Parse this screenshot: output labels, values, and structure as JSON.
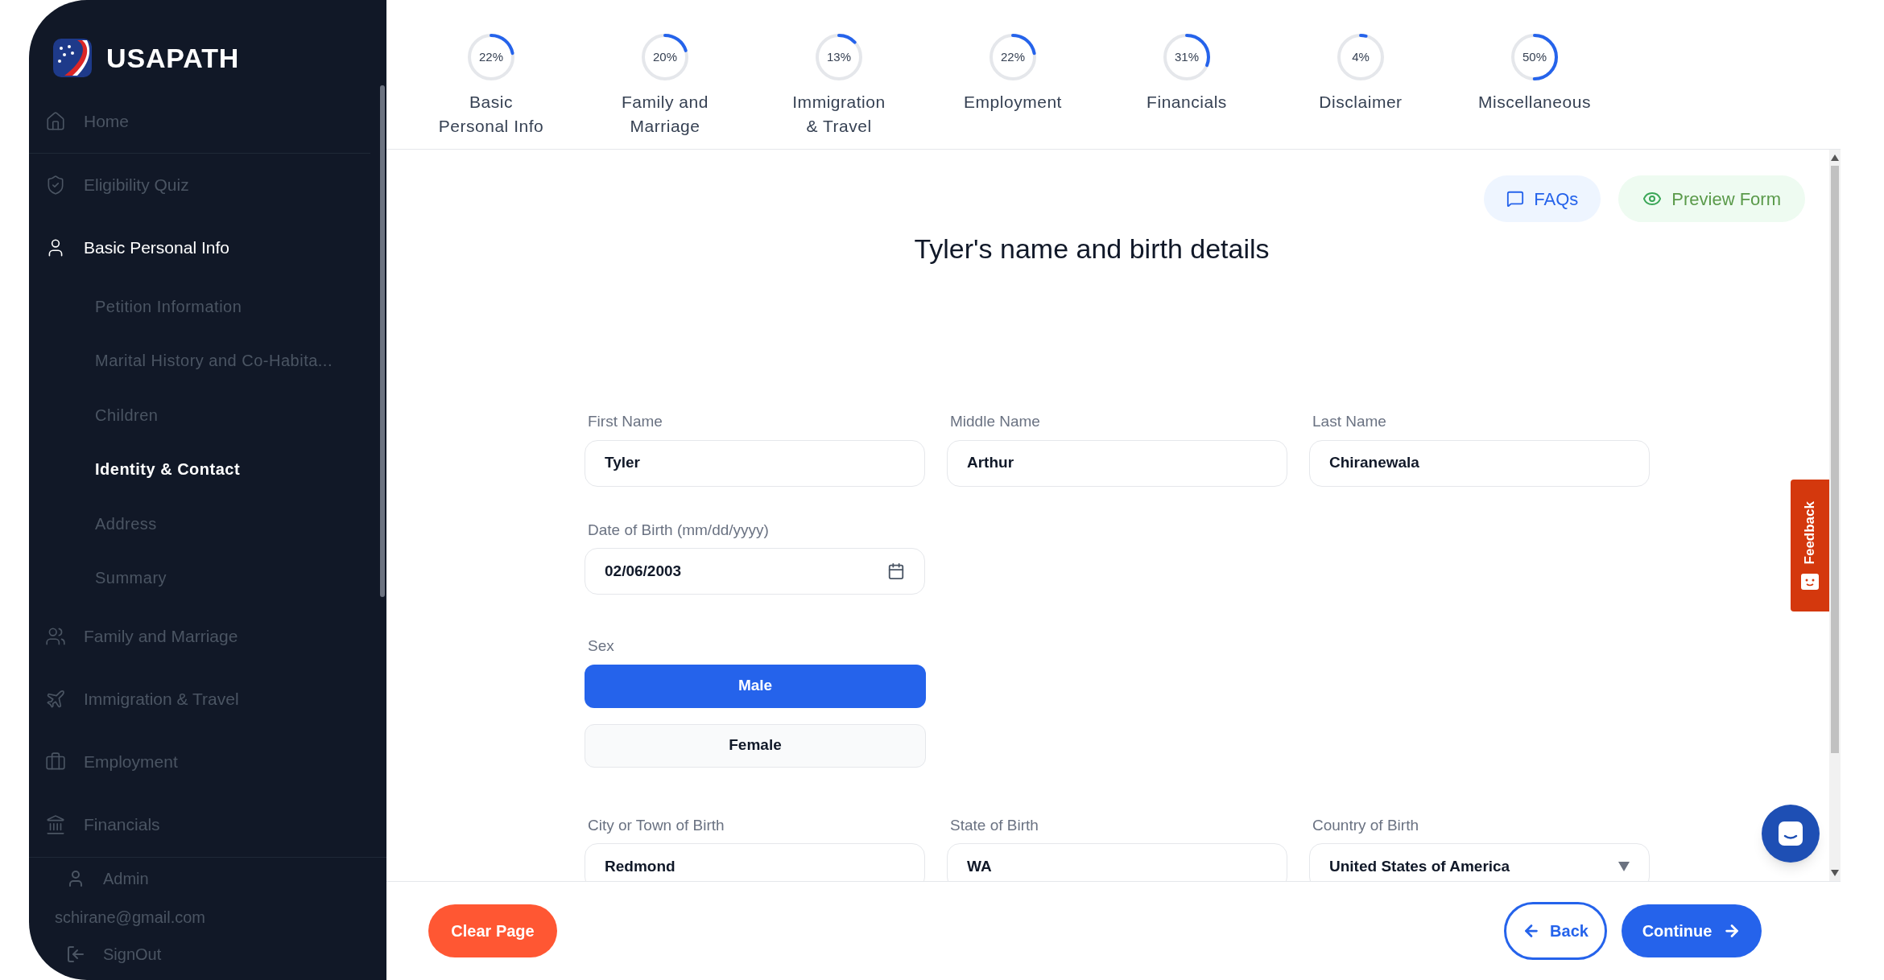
{
  "brand": {
    "name": "USAPATH"
  },
  "nav": [
    {
      "label": "Home",
      "selected": false
    },
    {
      "label": "Eligibility Quiz",
      "selected": false
    },
    {
      "label": "Basic Personal Info",
      "selected": true,
      "children": [
        {
          "label": "Petition Information",
          "selected": false
        },
        {
          "label": "Marital History and Co-Habita...",
          "selected": false
        },
        {
          "label": "Children",
          "selected": false
        },
        {
          "label": "Identity & Contact",
          "selected": true
        },
        {
          "label": "Address",
          "selected": false
        },
        {
          "label": "Summary",
          "selected": false
        }
      ]
    },
    {
      "label": "Family and Marriage",
      "selected": false
    },
    {
      "label": "Immigration & Travel",
      "selected": false
    },
    {
      "label": "Employment",
      "selected": false
    },
    {
      "label": "Financials",
      "selected": false
    }
  ],
  "user": {
    "name": "Admin",
    "email": "schirane@gmail.com",
    "signout": "SignOut"
  },
  "steps": [
    {
      "label": "Basic\nPersonal Info",
      "percent": "22%",
      "level": 0.22
    },
    {
      "label": "Family and\nMarriage",
      "percent": "20%",
      "level": 0.2
    },
    {
      "label": "Immigration\n& Travel",
      "percent": "13%",
      "level": 0.13
    },
    {
      "label": "Employment",
      "percent": "22%",
      "level": 0.22
    },
    {
      "label": "Financials",
      "percent": "31%",
      "level": 0.31
    },
    {
      "label": "Disclaimer",
      "percent": "4%",
      "level": 0.04
    },
    {
      "label": "Miscellaneous",
      "percent": "50%",
      "level": 0.5
    }
  ],
  "actions": {
    "faqs": "FAQs",
    "preview": "Preview Form"
  },
  "title": "Tyler's name and birth details",
  "name_fields": [
    {
      "label": "First Name",
      "value": "Tyler"
    },
    {
      "label": "Middle Name",
      "value": "Arthur"
    },
    {
      "label": "Last Name",
      "value": "Chiranewala"
    }
  ],
  "dob": {
    "label": "Date of Birth (mm/dd/yyyy)",
    "value": "02/06/2003"
  },
  "sex": {
    "label": "Sex",
    "options": [
      {
        "label": "Male",
        "selected": true
      },
      {
        "label": "Female",
        "selected": false
      }
    ]
  },
  "birth_fields": [
    {
      "label": "City or Town of Birth",
      "value": "Redmond",
      "kind": "text"
    },
    {
      "label": "State of Birth",
      "value": "WA",
      "kind": "text"
    },
    {
      "label": "Country of Birth",
      "value": "United States of America",
      "kind": "select"
    }
  ],
  "footer": {
    "clear": "Clear Page",
    "back": "Back",
    "continue": "Continue"
  },
  "feedback": "Feedback"
}
